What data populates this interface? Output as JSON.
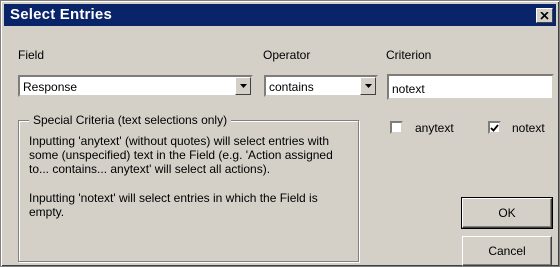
{
  "window": {
    "title": "Select Entries"
  },
  "labels": {
    "field": "Field",
    "operator": "Operator",
    "criterion": "Criterion"
  },
  "field_combo": {
    "value": "Response"
  },
  "operator_combo": {
    "value": "contains"
  },
  "criterion_input": {
    "value": "notext"
  },
  "special": {
    "title": "Special Criteria (text selections only)",
    "para1": "Inputting 'anytext' (without quotes) will select entries with some (unspecified) text in the Field   (e.g. 'Action assigned to... contains... anytext' will select all actions).",
    "para2": "Inputting 'notext' will select entries in which the Field is empty."
  },
  "checkboxes": {
    "anytext": {
      "label": "anytext",
      "checked": false
    },
    "notext": {
      "label": "notext",
      "checked": true
    }
  },
  "buttons": {
    "ok": "OK",
    "cancel": "Cancel"
  }
}
